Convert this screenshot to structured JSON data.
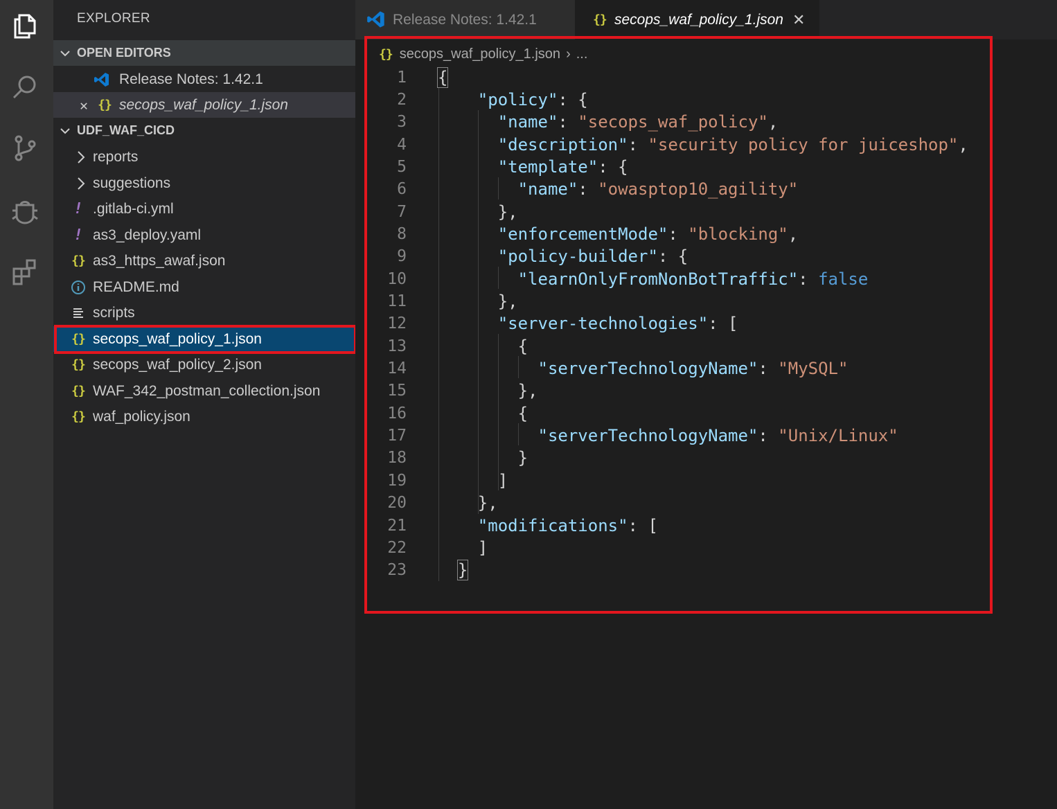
{
  "explorer": {
    "title": "EXPLORER",
    "open_editors": {
      "header": "OPEN EDITORS",
      "items": [
        {
          "label": "Release Notes: 1.42.1",
          "icon": "vscode-logo-icon"
        },
        {
          "label": "secops_waf_policy_1.json",
          "icon": "json-icon"
        }
      ]
    },
    "workspace": {
      "header": "UDF_WAF_CICD",
      "items": [
        {
          "label": "reports",
          "type": "folder"
        },
        {
          "label": "suggestions",
          "type": "folder"
        },
        {
          "label": ".gitlab-ci.yml",
          "type": "yaml"
        },
        {
          "label": "as3_deploy.yaml",
          "type": "yaml"
        },
        {
          "label": "as3_https_awaf.json",
          "type": "json"
        },
        {
          "label": "README.md",
          "type": "info"
        },
        {
          "label": "scripts",
          "type": "file"
        },
        {
          "label": "secops_waf_policy_1.json",
          "type": "json",
          "selected": true
        },
        {
          "label": "secops_waf_policy_2.json",
          "type": "json"
        },
        {
          "label": "WAF_342_postman_collection.json",
          "type": "json"
        },
        {
          "label": "waf_policy.json",
          "type": "json"
        }
      ]
    }
  },
  "tabs": [
    {
      "label": "Release Notes: 1.42.1",
      "active": false
    },
    {
      "label": "secops_waf_policy_1.json",
      "active": true
    }
  ],
  "editor": {
    "breadcrumb": {
      "file": "secops_waf_policy_1.json",
      "rest": "..."
    },
    "line_numbers": [
      "1",
      "2",
      "3",
      "4",
      "5",
      "6",
      "7",
      "8",
      "9",
      "10",
      "11",
      "12",
      "13",
      "14",
      "15",
      "16",
      "17",
      "18",
      "19",
      "20",
      "21",
      "22",
      "23"
    ]
  },
  "colors": {
    "highlight": "#e3161e",
    "selection": "#094771",
    "json_icon": "#cbcb41",
    "yaml_icon": "#a074c4"
  }
}
